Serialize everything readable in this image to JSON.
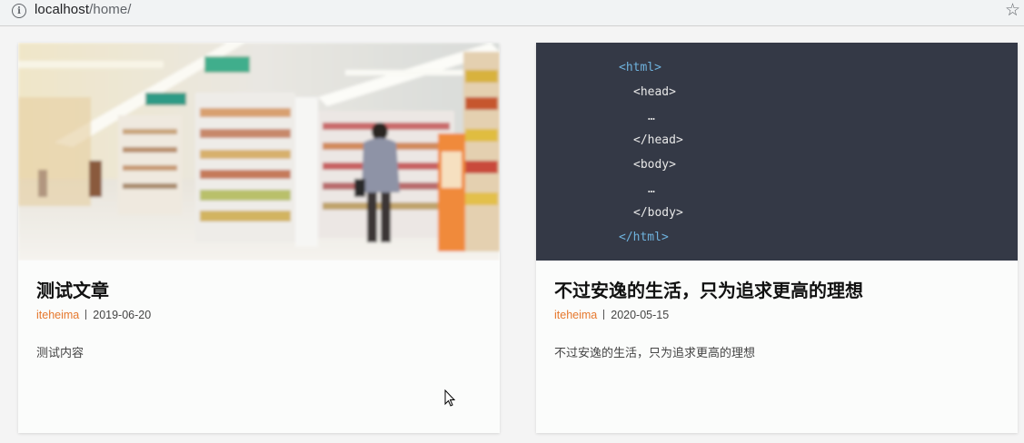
{
  "browser": {
    "url_host": "localhost",
    "url_path": "/home/"
  },
  "cards": [
    {
      "title": "测试文章",
      "author": "iteheima",
      "date": "2019-06-20",
      "excerpt": "测试内容",
      "image": "supermarket-aisle-photo"
    },
    {
      "title": "不过安逸的生活，只为追求更高的理想",
      "author": "iteheima",
      "date": "2020-05-15",
      "excerpt": "不过安逸的生活，只为追求更高的理想",
      "image": "html-code-snippet",
      "code_lines": [
        "<html>",
        "<head>",
        "…",
        "</head>",
        "<body>",
        "…",
        "</body>",
        "</html>"
      ]
    }
  ],
  "colors": {
    "author": "#e6782d",
    "code_bg": "#343946",
    "code_tag": "#6fb3de"
  }
}
